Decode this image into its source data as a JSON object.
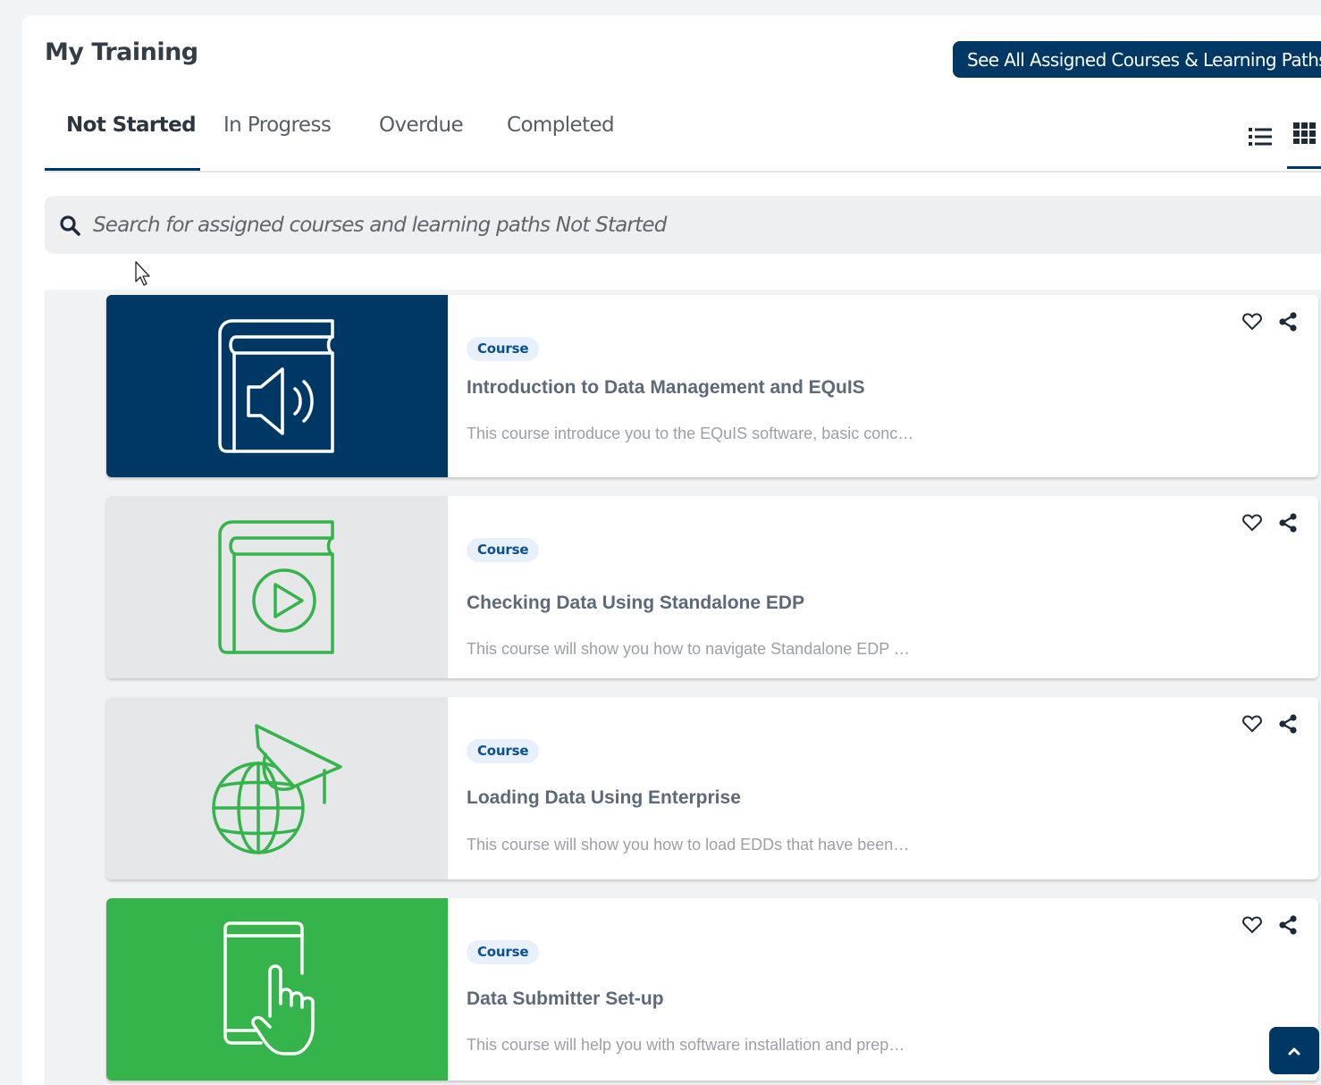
{
  "page": {
    "title": "My Training",
    "see_all_label": "See All Assigned Courses & Learning Paths"
  },
  "tabs": [
    {
      "label": "Not Started",
      "active": true
    },
    {
      "label": "In Progress",
      "active": false
    },
    {
      "label": "Overdue",
      "active": false
    },
    {
      "label": "Completed",
      "active": false
    }
  ],
  "view_toggle": {
    "options": [
      "list-view-icon",
      "grid-view-icon"
    ],
    "selected": "grid-view-icon"
  },
  "search": {
    "placeholder": "Search for assigned courses and learning paths Not Started",
    "value": ""
  },
  "courses": [
    {
      "type": "Course",
      "title": "Introduction to Data Management and EQuIS",
      "description": "This course introduce you to the EQuIS software, basic conc…",
      "thumbnail_icon": "audio-book-icon",
      "thumbnail_bg": "#003865",
      "icon_color": "#ffffff"
    },
    {
      "type": "Course",
      "title": "Checking Data Using Standalone EDP",
      "description": "This course will show you how to navigate Standalone EDP …",
      "thumbnail_icon": "video-book-icon",
      "thumbnail_bg": "#e6e7e8",
      "icon_color": "#34b44a"
    },
    {
      "type": "Course",
      "title": "Loading Data Using Enterprise",
      "description": "This course will show you how to load EDDs that have been…",
      "thumbnail_icon": "globe-graduation-cap-icon",
      "thumbnail_bg": "#e6e7e8",
      "icon_color": "#34b44a"
    },
    {
      "type": "Course",
      "title": "Data Submitter Set-up",
      "description": "This course will help you with software installation and prep…",
      "thumbnail_icon": "tablet-touch-icon",
      "thumbnail_bg": "#34b44a",
      "icon_color": "#ffffff"
    }
  ],
  "colors": {
    "primary": "#003865",
    "accent_green": "#34b44a",
    "badge_bg": "#e8f1fb",
    "badge_text": "#0b4f8f"
  }
}
